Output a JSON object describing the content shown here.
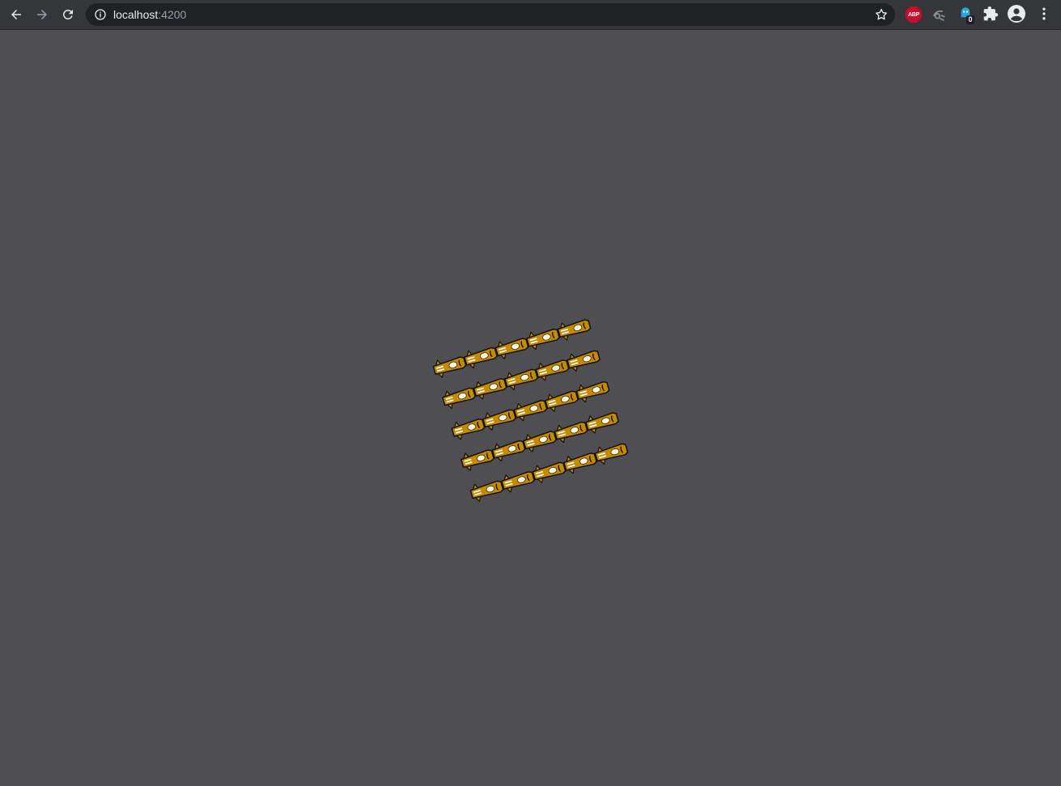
{
  "browser": {
    "url_host": "localhost",
    "url_port": ":4200",
    "icons": {
      "back": "back-arrow-icon",
      "forward": "forward-arrow-icon",
      "reload": "reload-icon",
      "site_info": "info-icon",
      "bookmark": "star-icon",
      "extensions": "puzzle-icon",
      "profile": "account-circle-icon",
      "menu": "kebab-menu-icon"
    },
    "extensions": {
      "abp_label": "ABP",
      "badge_count": "0"
    }
  },
  "scene": {
    "rows": 5,
    "columns": 5,
    "sprite": "yellow-slug-car",
    "colors": {
      "background": "#4e4e53",
      "body": "#c48a00",
      "outline": "#111111",
      "light": "#ffffff"
    }
  }
}
